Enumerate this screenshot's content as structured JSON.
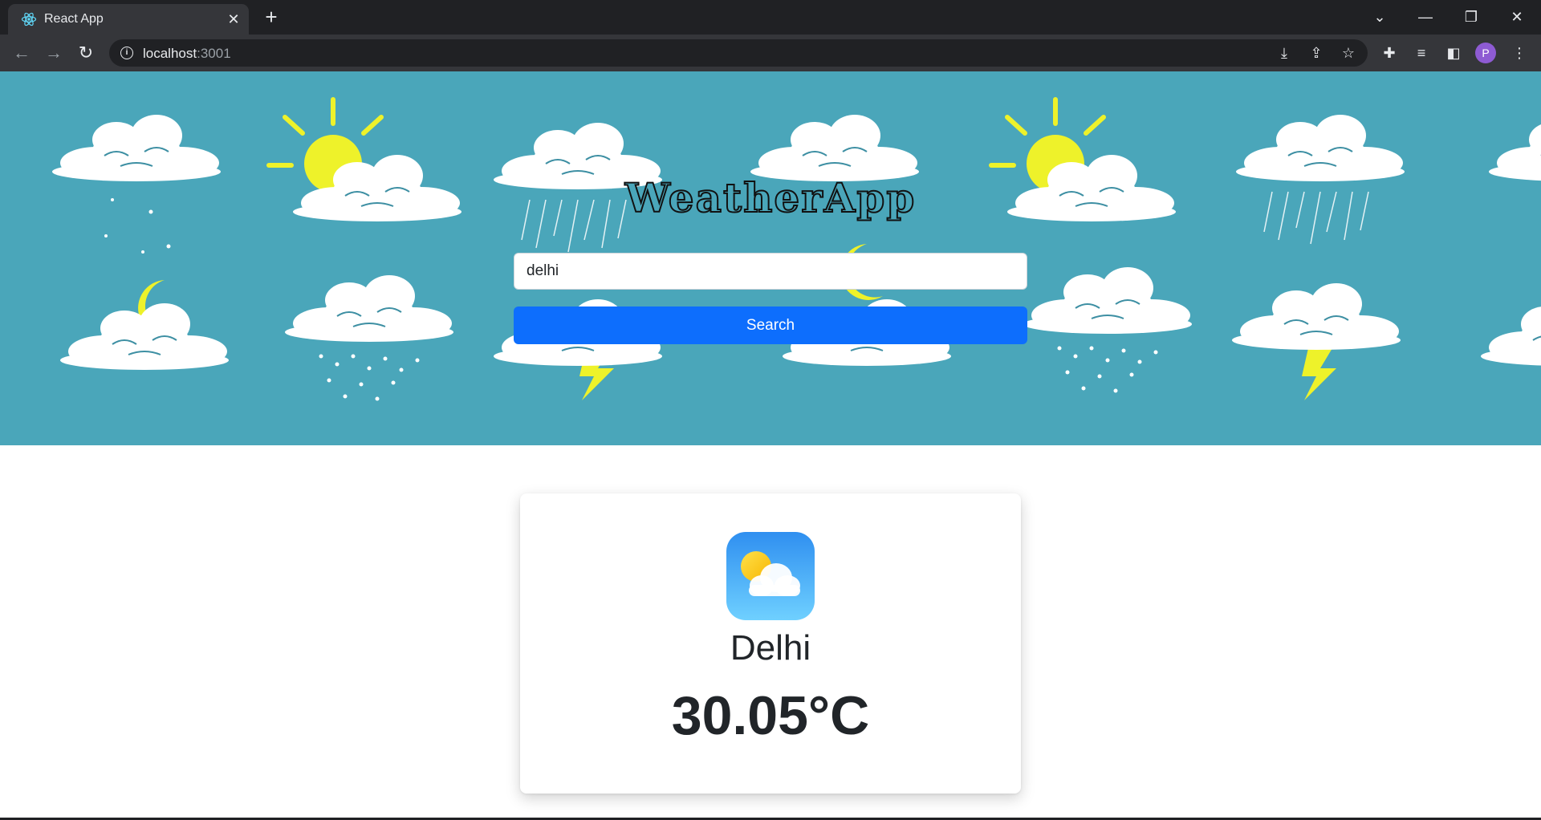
{
  "browser": {
    "tab_title": "React App",
    "url_host": "localhost",
    "url_port": ":3001",
    "profile_initial": "P"
  },
  "app": {
    "title": "WeatherApp",
    "search": {
      "value": "delhi",
      "button_label": "Search"
    },
    "result": {
      "city": "Delhi",
      "temperature": "30.05°C",
      "icon": "partly-cloudy-icon"
    },
    "colors": {
      "banner_bg": "#4aa6ba",
      "button": "#0d6efd",
      "sun": "#eef22a"
    }
  }
}
